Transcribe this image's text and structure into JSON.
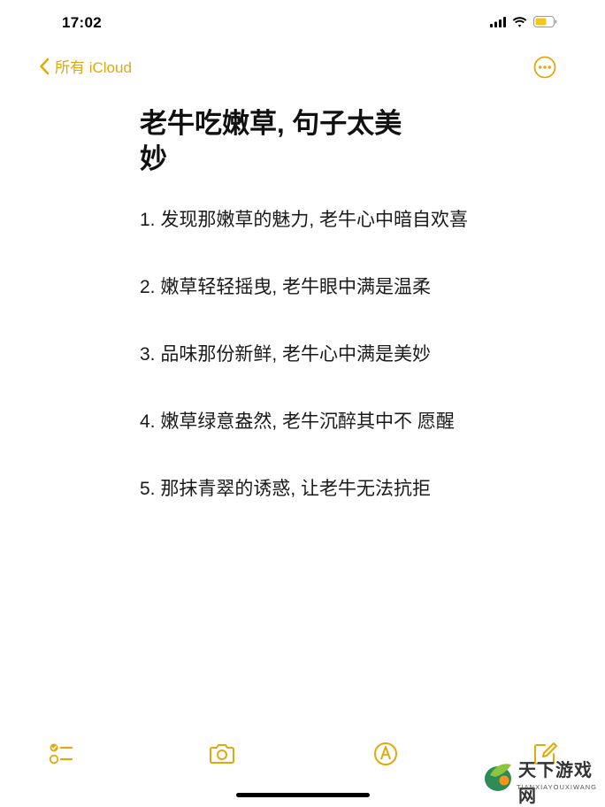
{
  "status_bar": {
    "time": "17:02",
    "icons": [
      "signal-icon",
      "wifi-icon",
      "battery-icon"
    ],
    "battery_color": "#f5c518"
  },
  "nav": {
    "back_label": "所有 iCloud",
    "back_icon": "chevron-left-icon",
    "more_icon": "more-icon",
    "accent_color": "#e1a90f"
  },
  "note": {
    "title": "老牛吃嫩草, 句子太美妙",
    "items": [
      "1. 发现那嫩草的魅力, 老牛心中暗自欢喜",
      "2. 嫩草轻轻摇曳, 老牛眼中满是温柔",
      " 3. 品味那份新鲜, 老牛心中满是美妙",
      "4. 嫩草绿意盎然, 老牛沉醉其中不 愿醒",
      "5. 那抹青翠的诱惑, 让老牛无法抗拒"
    ]
  },
  "toolbar": {
    "icons": [
      "checklist-icon",
      "camera-icon",
      "markup-icon",
      "compose-icon"
    ]
  },
  "watermark": {
    "title": "天下游戏网",
    "subtitle": "TIANXIAYOUXIWANG"
  }
}
